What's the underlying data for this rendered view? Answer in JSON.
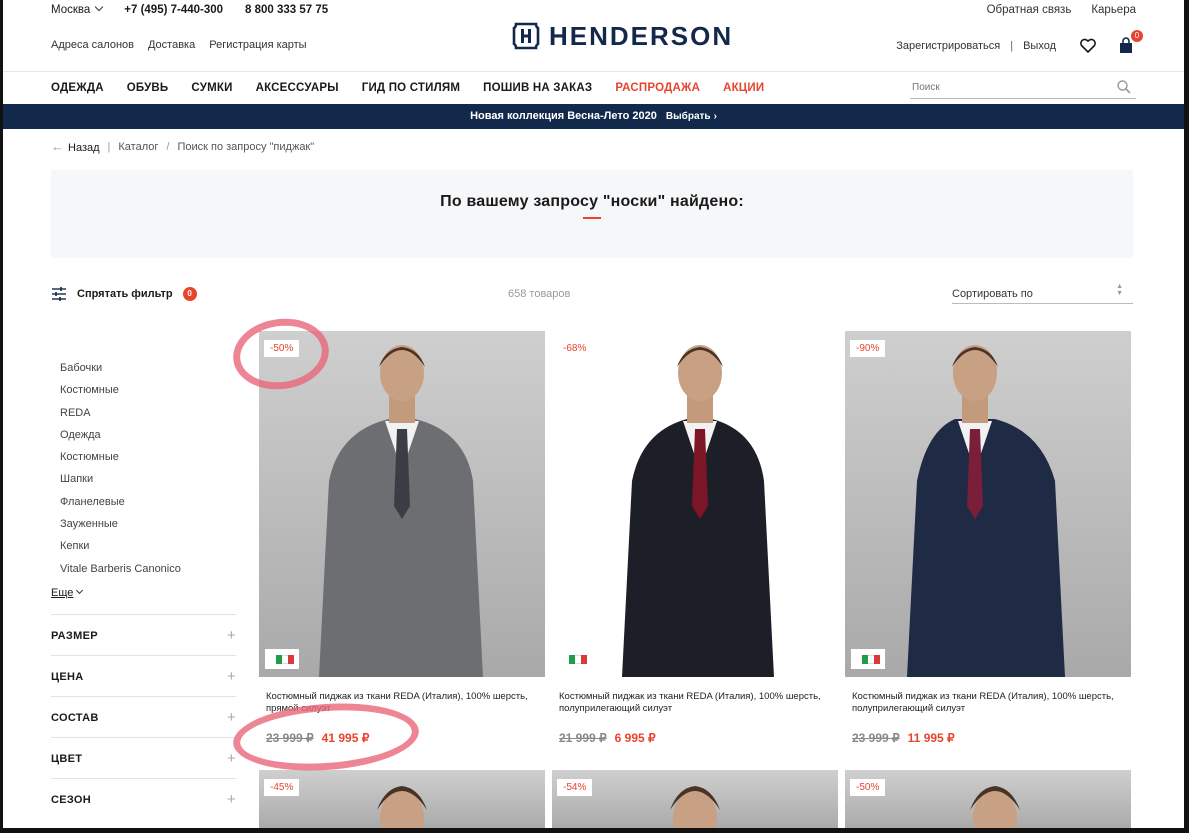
{
  "topbar": {
    "city": "Москва",
    "phone1": "+7 (495) 7-440-300",
    "phone2": "8 800 333 57 75",
    "feedback": "Обратная связь",
    "careers": "Карьера"
  },
  "subbar": [
    "Адреса салонов",
    "Доставка",
    "Регистрация карты"
  ],
  "brand": "HENDERSON",
  "account": {
    "register": "Зарегистрироваться",
    "separator": "|",
    "logout": "Выход",
    "cart_count": "0"
  },
  "nav": [
    {
      "label": "ОДЕЖДА",
      "sale": false
    },
    {
      "label": "ОБУВЬ",
      "sale": false
    },
    {
      "label": "СУМКИ",
      "sale": false
    },
    {
      "label": "АКСЕССУАРЫ",
      "sale": false
    },
    {
      "label": "ГИД ПО СТИЛЯМ",
      "sale": false
    },
    {
      "label": "ПОШИВ НА ЗАКАЗ",
      "sale": false
    },
    {
      "label": "РАСПРОДАЖА",
      "sale": true
    },
    {
      "label": "АКЦИИ",
      "sale": true
    }
  ],
  "search": {
    "placeholder": "Поиск"
  },
  "promo": {
    "text": "Новая коллекция Весна-Лето 2020",
    "cta": "Выбрать"
  },
  "breadcrumb": {
    "back": "Назад",
    "catalog": "Каталог",
    "current": "Поиск по запросу \"пиджак\""
  },
  "hero": {
    "title": "По вашему запросу \"носки\" найдено:"
  },
  "filter": {
    "toggle_label": "Спрятать фильтр",
    "count": "0"
  },
  "results": {
    "count": "658 товаров",
    "sort_label": "Сортировать по"
  },
  "categories": [
    "Бабочки",
    "Костюмные",
    "REDA",
    "Одежда",
    "Костюмные",
    "Шапки",
    "Фланелевые",
    "Зауженные",
    "Кепки",
    "Vitale Barberis Canonico"
  ],
  "more_label": "Еще",
  "facets": [
    "РАЗМЕР",
    "ЦЕНА",
    "СОСТАВ",
    "ЦВЕТ",
    "СЕЗОН"
  ],
  "products": [
    {
      "discount": "-50%",
      "title": "Костюмный пиджак из ткани REDA (Италия), 100% шерсть, прямой силуэт",
      "old_price": "23 999  ₽",
      "new_price": "41 995  ₽",
      "suit": "#6d6e72",
      "tie": "#3a3d44",
      "bg": "grey"
    },
    {
      "discount": "-68%",
      "title": "Костюмный пиджак из ткани REDA (Италия), 100% шерсть, полуприлегающий силуэт",
      "old_price": "21 999  ₽",
      "new_price": "6 995  ₽",
      "suit": "#1c1f28",
      "tie": "#7c1526",
      "bg": "white"
    },
    {
      "discount": "-90%",
      "title": "Костюмный пиджак из ткани REDA (Италия), 100% шерсть, полуприлегающий силуэт",
      "old_price": "23 999  ₽",
      "new_price": "11 995  ₽",
      "suit": "#1f2a44",
      "tie": "#7a1e3a",
      "bg": "grey"
    },
    {
      "discount": "-45%",
      "bg": "grey"
    },
    {
      "discount": "-54%",
      "bg": "grey"
    },
    {
      "discount": "-50%",
      "bg": "grey"
    }
  ],
  "colors": {
    "accent": "#e8442d",
    "navy": "#13294b",
    "annotation": "#e8667a"
  }
}
